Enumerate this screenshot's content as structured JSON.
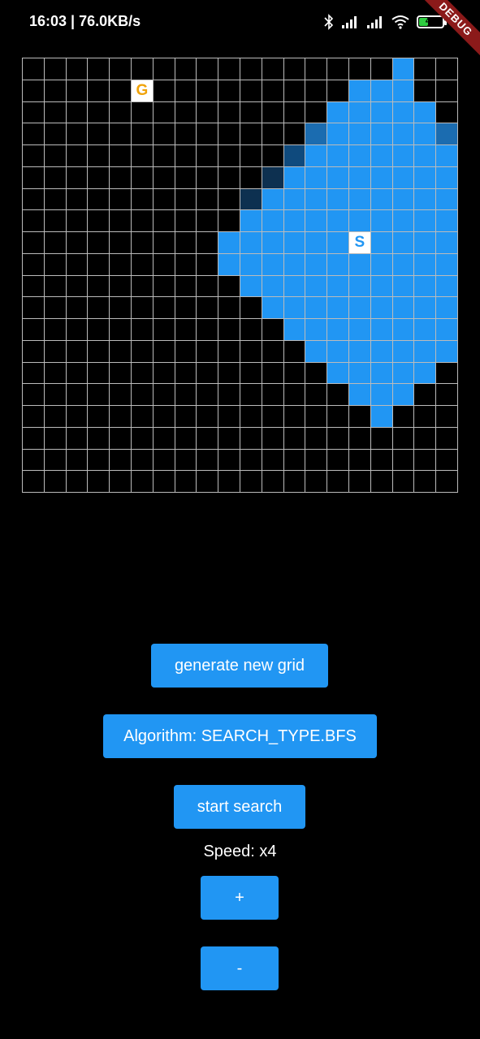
{
  "status_bar": {
    "time": "16:03 | 76.0KB/s",
    "battery_level": "40",
    "icons": [
      "bluetooth-icon",
      "signal-icon",
      "signal-icon",
      "wifi-icon",
      "battery-icon"
    ]
  },
  "debug_banner": "DEBUG",
  "grid": {
    "rows": 20,
    "cols": 20,
    "goal_label": "G",
    "start_label": "S",
    "colors": {
      "empty": "#000000",
      "visited": "#2196f3",
      "frontier_dark": "#0d3050",
      "frontier_mid": "#0f4a7d",
      "frontier_light": "#1b6cb0",
      "marker_bg": "#ffffff",
      "goal_text": "#f0a30a",
      "start_text": "#2196f3",
      "grid_line": "#bbbbbb"
    },
    "cells": [
      "                 V  ",
      "     G         VVV  ",
      "              VVVVV ",
      "             LVVVVVL",
      "            MVVVVVVV",
      "           DVVVVVVVV",
      "          DVVVVVVVVV",
      "          VVVVVVVVVV",
      "         VVVVVVSVVVV",
      "         VVVVVVVVVVV",
      "          VVVVVVVVVV",
      "           VVVVVVVVV",
      "            VVVVVVVV",
      "             VVVVVVV",
      "              VVVVV ",
      "               VVV  ",
      "                V   ",
      "                    ",
      "                    ",
      "                    "
    ]
  },
  "buttons": {
    "generate": "generate new grid",
    "algorithm": "Algorithm: SEARCH_TYPE.BFS",
    "start": "start search",
    "plus": "+",
    "minus": "-"
  },
  "speed_label": "Speed: x4"
}
